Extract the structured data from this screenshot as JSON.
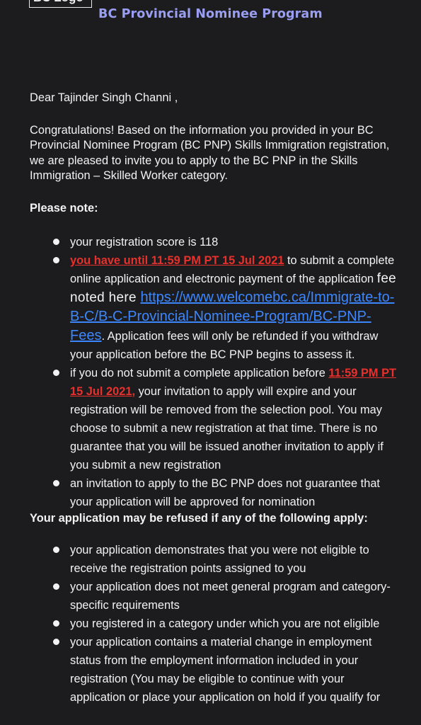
{
  "header": {
    "logo_text": "BC Logo",
    "program_title": "BC Provincial Nominee Program"
  },
  "letter": {
    "salutation": "Dear Tajinder Singh  Channi ,",
    "intro": "Congratulations! Based on the information you provided in your BC Provincial Nominee Program (BC PNP) Skills Immigration registration, we are pleased to invite you to apply to the BC PNP in the Skills Immigration – Skilled Worker category.",
    "note_heading": "Please note:",
    "note_items": {
      "score": "your registration score is 118",
      "deadline": {
        "red_prefix": "you have ",
        "red_date": "until 11:59 PM PT 15 Jul 2021",
        "text_a": " to submit a complete online application and electronic payment of the application ",
        "text_b": "fee noted here ",
        "link": "https://www.welcomebc.ca/Immigrate-to-B-C/B-C-Provincial-Nominee-Program/BC-PNP-Fees",
        "text_c": ". Application fees will only be refunded if you withdraw your application before the BC PNP begins to assess it."
      },
      "expire": {
        "text_a": "if you do not submit a complete application before ",
        "red_date": "11:59 PM PT 15 Jul 2021,",
        "text_b": " your invitation to apply will expire and your registration will be removed from the selection pool. You may choose to submit a new registration at that time.  There is no guarantee that you will be issued another invitation to apply if you submit a new registration"
      },
      "guarantee": "an invitation to apply to the BC PNP does not guarantee that your application will be approved for nomination"
    },
    "refusal_heading": "Your application may be refused if any of the following apply:",
    "refusal_items": [
      "your application demonstrates that you were not eligible to receive the registration points assigned to you",
      "your application does not meet general program and category-specific requirements",
      "you registered in a category under which you are not eligible",
      "your application contains a material change in employment status from the employment information included in your registration (You may be eligible to continue with your application or place your application on hold if you qualify for"
    ]
  }
}
